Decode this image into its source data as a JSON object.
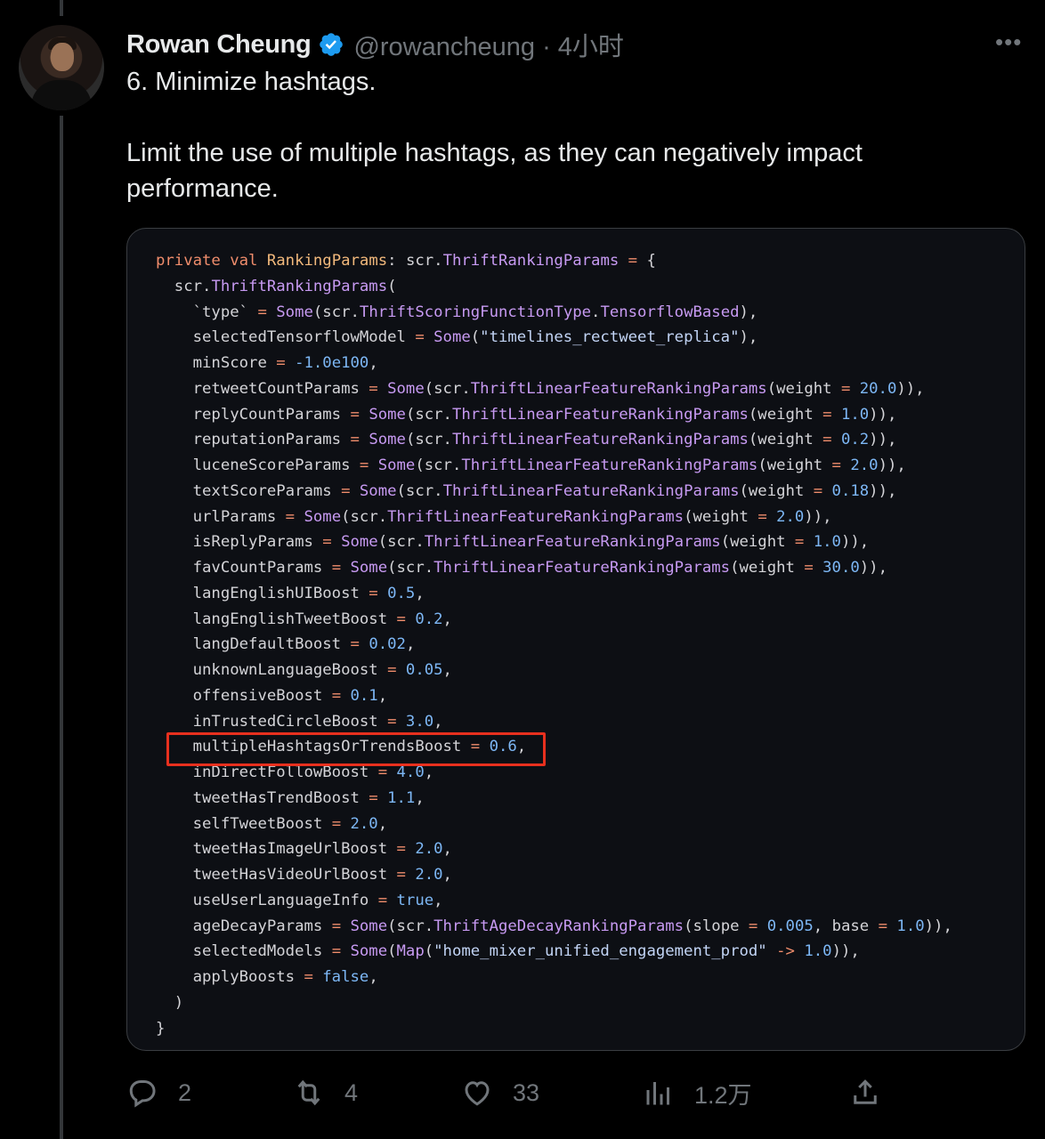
{
  "tweet": {
    "author_name": "Rowan Cheung",
    "handle_time": "@rowancheung · 4小时",
    "title": "6. Minimize hashtags.",
    "body": "Limit the use of multiple hashtags, as they can negatively impact performance.",
    "more_label": "•••"
  },
  "code_image": {
    "highlight_color": "#e8301e",
    "highlighted_line": "multipleHashtagsOrTrendsBoost = 0.6,",
    "lines": [
      "private val RankingParams: scr.ThriftRankingParams = {",
      "  scr.ThriftRankingParams(",
      "    `type` = Some(scr.ThriftScoringFunctionType.TensorflowBased),",
      "    selectedTensorflowModel = Some(\"timelines_rectweet_replica\"),",
      "    minScore = -1.0e100,",
      "    retweetCountParams = Some(scr.ThriftLinearFeatureRankingParams(weight = 20.0)),",
      "    replyCountParams = Some(scr.ThriftLinearFeatureRankingParams(weight = 1.0)),",
      "    reputationParams = Some(scr.ThriftLinearFeatureRankingParams(weight = 0.2)),",
      "    luceneScoreParams = Some(scr.ThriftLinearFeatureRankingParams(weight = 2.0)),",
      "    textScoreParams = Some(scr.ThriftLinearFeatureRankingParams(weight = 0.18)),",
      "    urlParams = Some(scr.ThriftLinearFeatureRankingParams(weight = 2.0)),",
      "    isReplyParams = Some(scr.ThriftLinearFeatureRankingParams(weight = 1.0)),",
      "    favCountParams = Some(scr.ThriftLinearFeatureRankingParams(weight = 30.0)),",
      "    langEnglishUIBoost = 0.5,",
      "    langEnglishTweetBoost = 0.2,",
      "    langDefaultBoost = 0.02,",
      "    unknownLanguageBoost = 0.05,",
      "    offensiveBoost = 0.1,",
      "    inTrustedCircleBoost = 3.0,",
      "    multipleHashtagsOrTrendsBoost = 0.6,",
      "    inDirectFollowBoost = 4.0,",
      "    tweetHasTrendBoost = 1.1,",
      "    selfTweetBoost = 2.0,",
      "    tweetHasImageUrlBoost = 2.0,",
      "    tweetHasVideoUrlBoost = 2.0,",
      "    useUserLanguageInfo = true,",
      "    ageDecayParams = Some(scr.ThriftAgeDecayRankingParams(slope = 0.005, base = 1.0)),",
      "    selectedModels = Some(Map(\"home_mixer_unified_engagement_prod\" -> 1.0)),",
      "    applyBoosts = false,",
      "  )",
      "}"
    ]
  },
  "actions": {
    "reply_count": "2",
    "retweet_count": "4",
    "like_count": "33",
    "views_count": "1.2万"
  },
  "icons": [
    "verified-badge-icon",
    "more-icon",
    "reply-icon",
    "retweet-icon",
    "like-icon",
    "views-icon",
    "share-icon"
  ]
}
